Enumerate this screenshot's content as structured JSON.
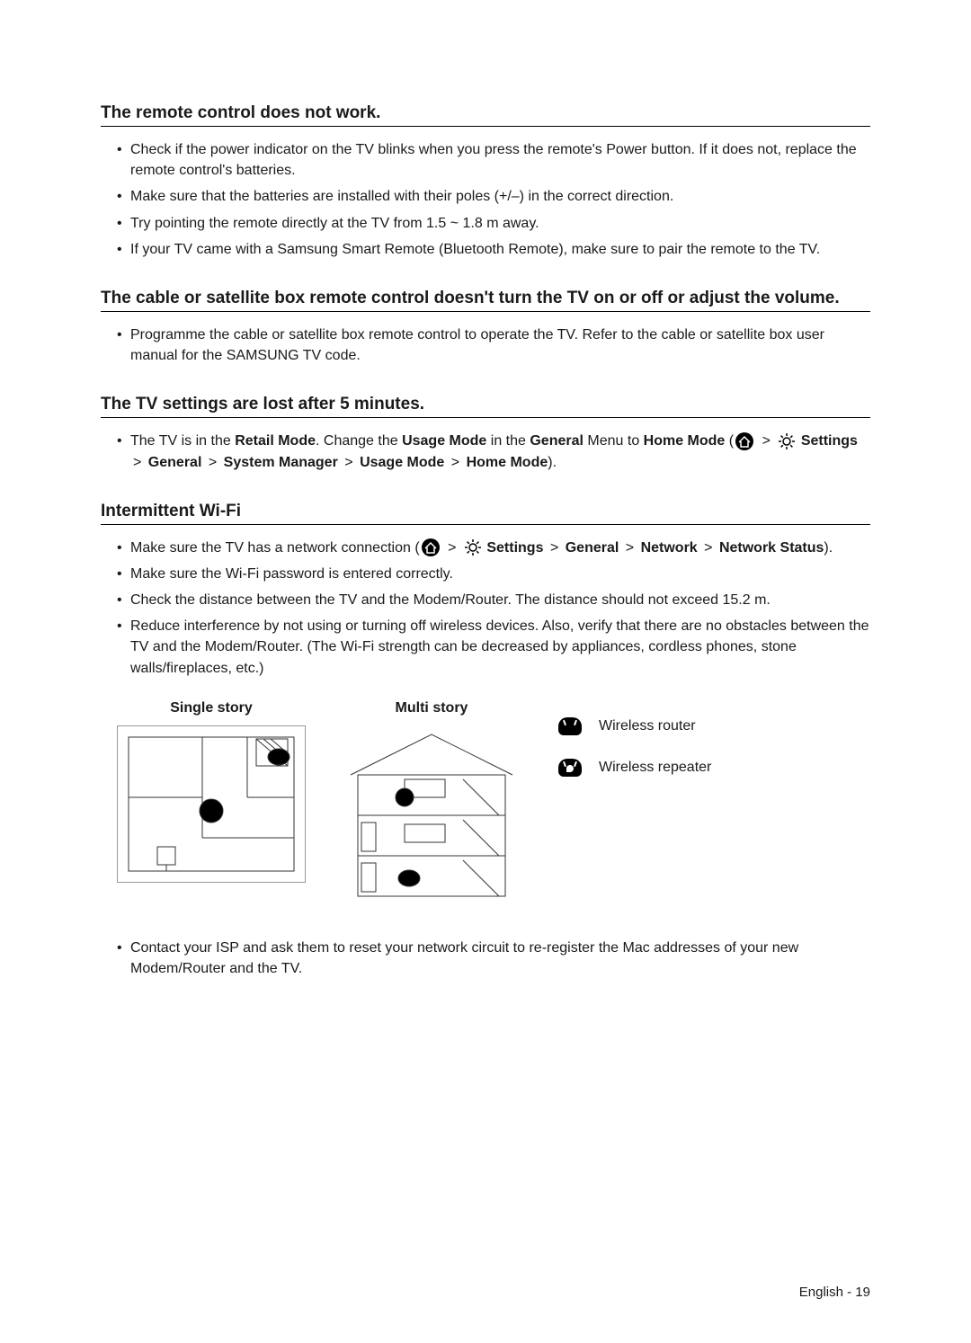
{
  "sections": {
    "remote": {
      "title": "The remote control does not work.",
      "items": [
        "Check if the power indicator on the TV blinks when you press the remote's Power button. If it does not, replace the remote control's batteries.",
        "Make sure that the batteries are installed with their poles (+/–) in the correct direction.",
        "Try pointing the remote directly at the TV from 1.5 ~ 1.8 m away.",
        "If your TV came with a Samsung Smart Remote (Bluetooth Remote), make sure to pair the remote to the TV."
      ]
    },
    "cable": {
      "title": "The cable or satellite box remote control doesn't turn the TV on or off or adjust the volume.",
      "items": [
        "Programme the cable or satellite box remote control to operate the TV. Refer to the cable or satellite box user manual for the SAMSUNG TV code."
      ]
    },
    "settings_lost": {
      "title": "The TV settings are lost after 5 minutes.",
      "item_prefix": "The TV is in the ",
      "retail_mode": "Retail Mode",
      "item_mid1": ". Change the ",
      "usage_mode": "Usage Mode",
      "item_mid2": " in the ",
      "general": "General",
      "item_mid3": " Menu to ",
      "home_mode": "Home Mode",
      "paren_open": " (",
      "settings": "Settings",
      "system_manager": "System Manager",
      "paren_close": ")."
    },
    "wifi": {
      "title": "Intermittent Wi-Fi",
      "item1_prefix": "Make sure the TV has a network connection (",
      "settings": "Settings",
      "general": "General",
      "network": "Network",
      "network_status": "Network Status",
      "item1_suffix": ").",
      "other_items": [
        "Make sure the Wi-Fi password is entered correctly.",
        "Check the distance between the TV and the Modem/Router. The distance should not exceed 15.2 m.",
        "Reduce interference by not using or turning off wireless devices. Also, verify that there are no obstacles between the TV and the Modem/Router. (The Wi-Fi strength can be decreased by appliances, cordless phones, stone walls/fireplaces, etc.)"
      ],
      "diagram_single": "Single story",
      "diagram_multi": "Multi story",
      "legend_router": "Wireless router",
      "legend_repeater": "Wireless repeater",
      "contact_isp": "Contact your ISP and ask them to reset your network circuit to re-register the Mac addresses of your new Modem/Router and the TV."
    }
  },
  "nav": {
    "chevron": ">"
  },
  "footer": {
    "text": "English - 19"
  }
}
